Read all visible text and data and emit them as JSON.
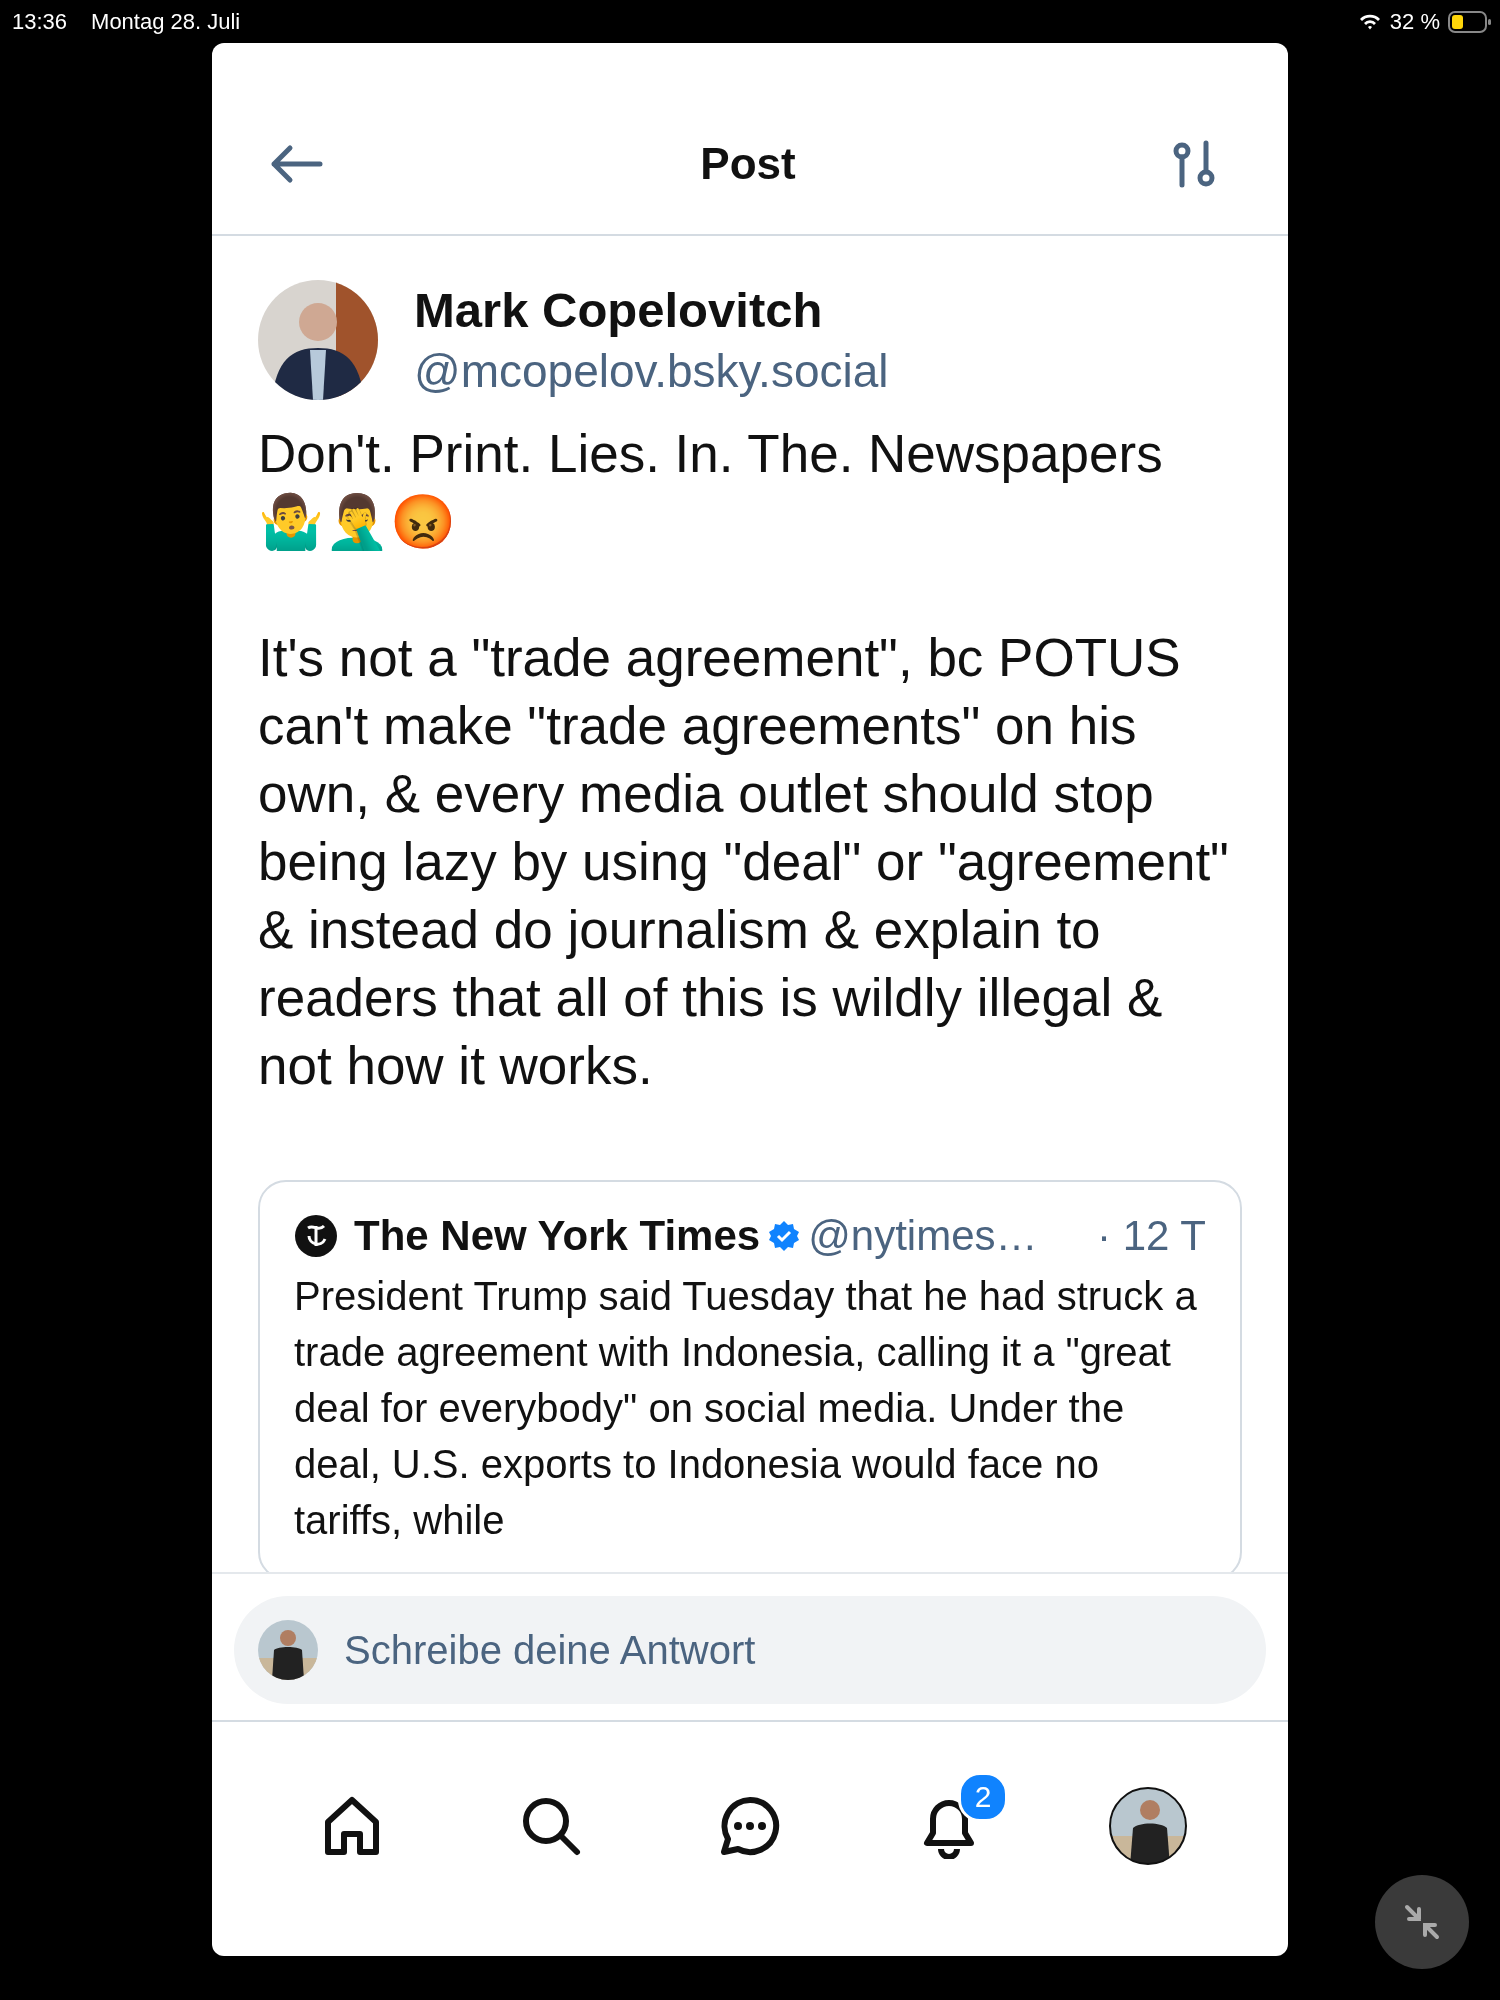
{
  "status_bar": {
    "time": "13:36",
    "date": "Montag 28. Juli",
    "battery": "32 %"
  },
  "header": {
    "title": "Post"
  },
  "post": {
    "author": {
      "name": "Mark Copelovitch",
      "handle": "@mcopelov.bsky.social"
    },
    "paragraphs": [
      "Don't. Print. Lies. In. The. Newspapers",
      "🤷‍♂️🤦‍♂️😡",
      "It's not a \"trade agreement\", bc POTUS can't make \"trade agreements\" on his own, & every media outlet should stop being lazy by using \"deal\" or \"agreement\" & instead do journalism & explain to readers that all of this is wildly illegal & not how it works."
    ],
    "quote": {
      "author": "The New York Times",
      "verified": true,
      "handle": "@nytimes…",
      "time": "· 12 T",
      "text": "President Trump said Tuesday that he had struck a trade agreement with Indonesia, calling it a \"great deal for everybody\" on social media. Under the deal, U.S. exports to Indonesia would face no tariffs, while"
    }
  },
  "reply": {
    "placeholder": "Schreibe deine Antwort"
  },
  "nav": [
    {
      "kind": "home"
    },
    {
      "kind": "search"
    },
    {
      "kind": "chat"
    },
    {
      "kind": "notifications",
      "badge": "2"
    },
    {
      "kind": "profile"
    }
  ]
}
